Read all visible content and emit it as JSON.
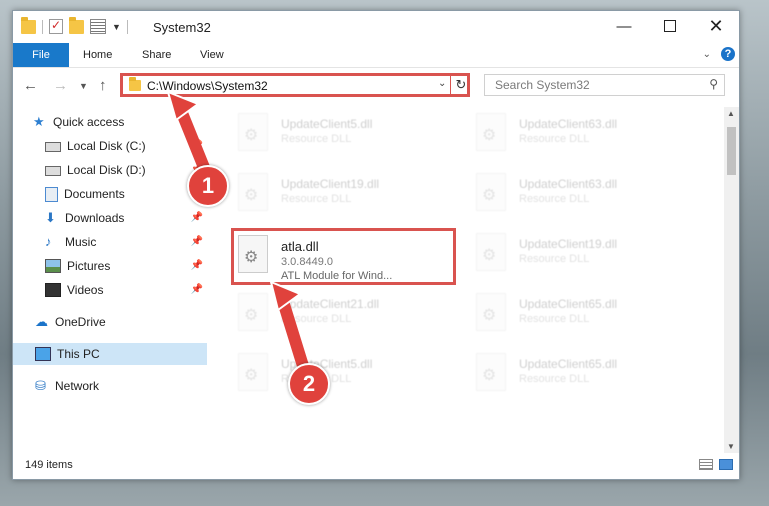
{
  "window": {
    "title": "System32",
    "controls": {
      "minimize": "—",
      "maximize": "",
      "close": "✕"
    }
  },
  "ribbon": {
    "tabs": [
      "File",
      "Home",
      "Share",
      "View"
    ],
    "help": "?"
  },
  "address": {
    "path": "C:\\Windows\\System32",
    "search_placeholder": "Search System32"
  },
  "sidebar": {
    "items": [
      {
        "label": "Quick access",
        "icon": "star-icon"
      },
      {
        "label": "Local Disk (C:)",
        "icon": "drive-icon",
        "pinned": true
      },
      {
        "label": "Local Disk (D:)",
        "icon": "drive-icon",
        "pinned": true
      },
      {
        "label": "Documents",
        "icon": "documents-icon",
        "pinned": true
      },
      {
        "label": "Downloads",
        "icon": "downloads-icon",
        "pinned": true
      },
      {
        "label": "Music",
        "icon": "music-icon",
        "pinned": true
      },
      {
        "label": "Pictures",
        "icon": "pictures-icon",
        "pinned": true
      },
      {
        "label": "Videos",
        "icon": "videos-icon",
        "pinned": true
      },
      {
        "label": "OneDrive",
        "icon": "cloud-icon"
      },
      {
        "label": "This PC",
        "icon": "pc-icon",
        "selected": true
      },
      {
        "label": "Network",
        "icon": "network-icon"
      }
    ]
  },
  "files": {
    "left": [
      {
        "name": "UpdateClient5.dll",
        "desc": "Resource DLL"
      },
      {
        "name": "UpdateClient19.dll",
        "desc": "Resource DLL"
      },
      {
        "name": "atla.dll",
        "desc": "3.0.8449.0",
        "desc2": "ATL Module for Wind..."
      },
      {
        "name": "UpdateClient21.dll",
        "desc": "Resource DLL"
      },
      {
        "name": "UpdateClient5.dll",
        "desc": "Resource DLL"
      }
    ],
    "right": [
      {
        "name": "UpdateClient63.dll",
        "desc": "Resource DLL"
      },
      {
        "name": "UpdateClient63.dll",
        "desc": "Resource DLL"
      },
      {
        "name": "UpdateClient19.dll",
        "desc": "Resource DLL"
      },
      {
        "name": "UpdateClient65.dll",
        "desc": "Resource DLL"
      },
      {
        "name": "UpdateClient65.dll",
        "desc": "Resource DLL"
      }
    ]
  },
  "status": {
    "count": "149 items"
  },
  "annotations": {
    "marker1": "1",
    "marker2": "2",
    "color": "#e0423c"
  }
}
